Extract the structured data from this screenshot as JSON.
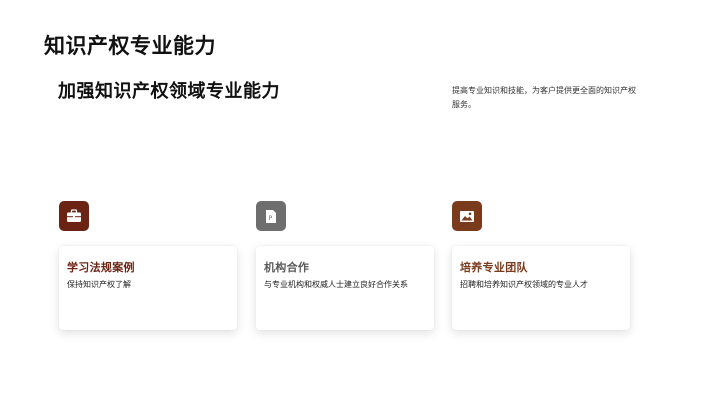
{
  "page": {
    "title": "知识产权专业能力",
    "subtitle": "加强知识产权领域专业能力",
    "intro": "提高专业知识和技能，为客户提供更全面的知识产权服务。"
  },
  "cards": [
    {
      "title": "学习法规案例",
      "desc": "保持知识产权了解",
      "icon": "briefcase-icon",
      "icon_color": "#6B2414",
      "title_color": "#6B2414"
    },
    {
      "title": "机构合作",
      "desc": "与专业机构和权威人士建立良好合作关系",
      "icon": "document-icon",
      "icon_color": "#6E6E6E",
      "title_color": "#5A5A5A"
    },
    {
      "title": "培养专业团队",
      "desc": "招聘和培养知识产权领域的专业人才",
      "icon": "image-icon",
      "icon_color": "#7A3A1C",
      "title_color": "#7A3A1C"
    }
  ]
}
